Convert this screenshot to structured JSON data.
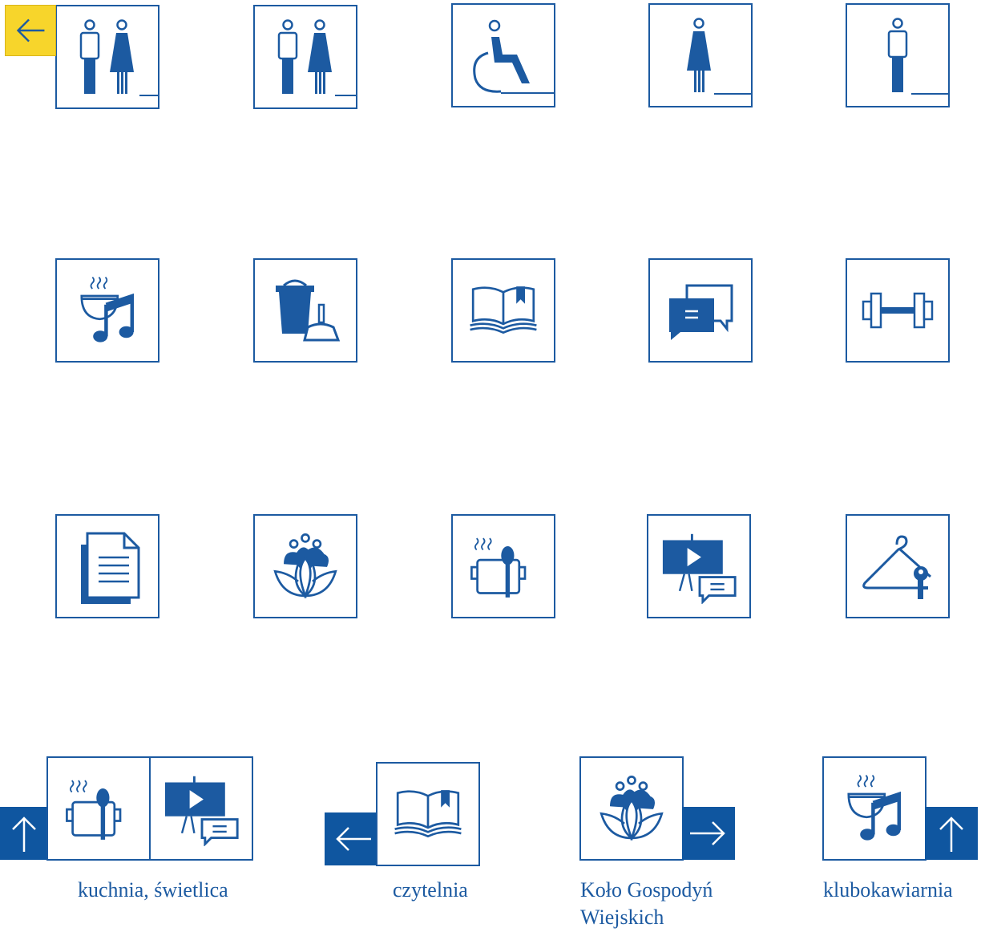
{
  "captions": {
    "kitchen_lounge": "kuchnia, świetlica",
    "reading_room": "czytelnia",
    "housewives_line1": "Koło Gospodyń",
    "housewives_line2": "Wiejskich",
    "club_cafe": "klubokawiarnia"
  },
  "icons": [
    "toilets-unisex-icon",
    "toilets-unisex-icon",
    "wheelchair-icon",
    "women-toilet-icon",
    "men-toilet-icon",
    "cafe-music-icon",
    "cleaning-icon",
    "book-icon",
    "conversation-icon",
    "gym-dumbbell-icon",
    "documents-icon",
    "lotus-icon",
    "kitchen-pot-icon",
    "presentation-icon",
    "cloakroom-icon"
  ],
  "colors": {
    "brand_blue": "#1c5aa1",
    "arrow_blue": "#0f56a0",
    "highlight_yellow": "#f7d52b"
  }
}
